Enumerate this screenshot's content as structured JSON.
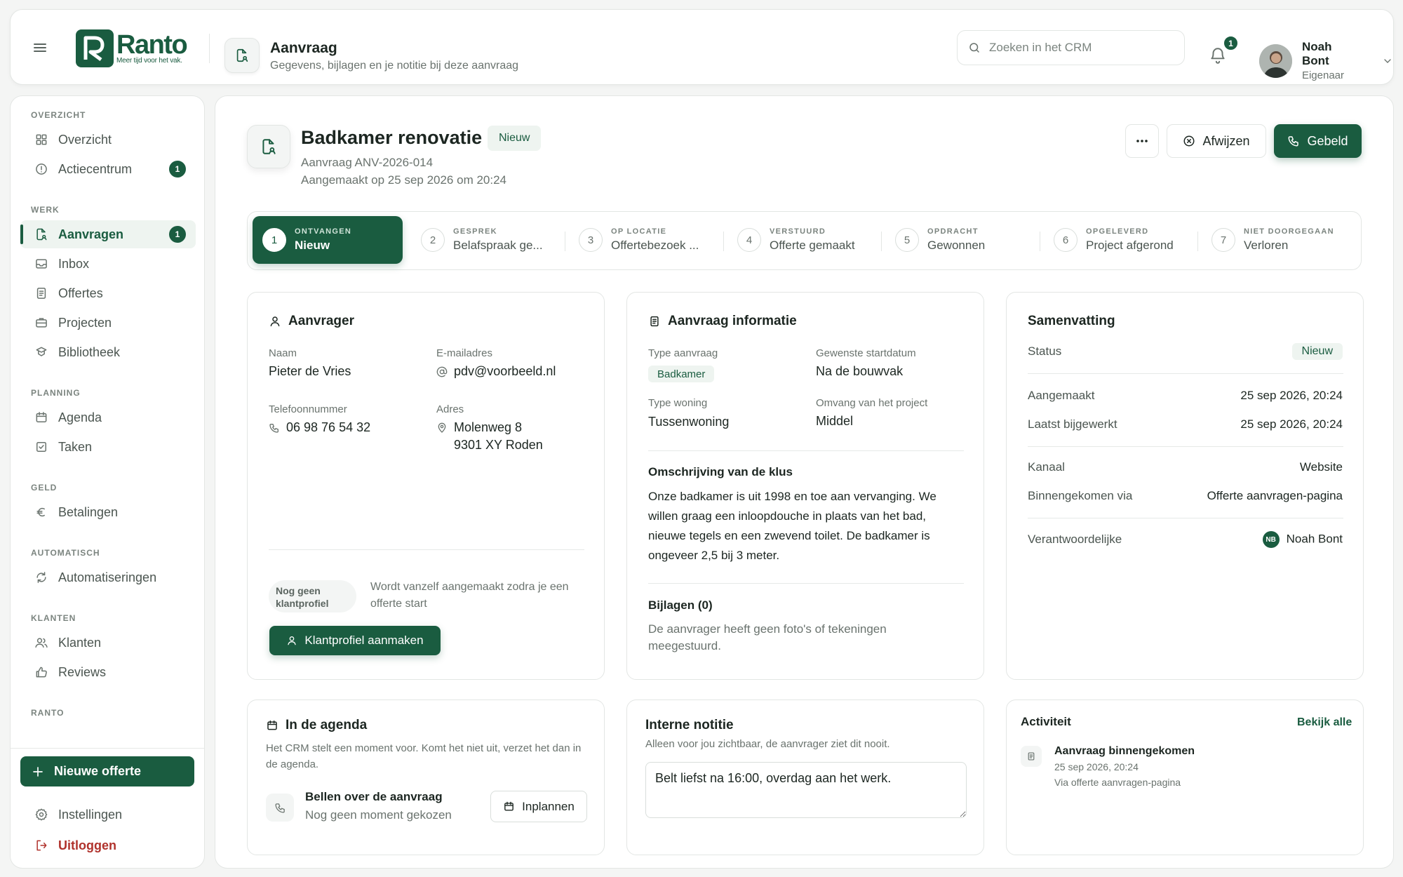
{
  "app": {
    "logo_name": "Ranto",
    "logo_tagline": "Meer tijd voor het vak.",
    "header_title": "Aanvraag",
    "header_subtitle": "Gegevens, bijlagen en je notitie bij deze aanvraag",
    "search_placeholder": "Zoeken in het CRM",
    "notification_count": "1",
    "user_name": "Noah Bont",
    "user_role": "Eigenaar"
  },
  "sidebar": {
    "sections": {
      "overzicht": "OVERZICHT",
      "werk": "WERK",
      "planning": "PLANNING",
      "geld": "GELD",
      "automatisch": "AUTOMATISCH",
      "klanten": "KLANTEN",
      "ranto": "RANTO"
    },
    "items": {
      "overzicht": "Overzicht",
      "actiecentrum": "Actiecentrum",
      "actiecentrum_badge": "1",
      "aanvragen": "Aanvragen",
      "aanvragen_badge": "1",
      "inbox": "Inbox",
      "offertes": "Offertes",
      "projecten": "Projecten",
      "bibliotheek": "Bibliotheek",
      "agenda": "Agenda",
      "taken": "Taken",
      "betalingen": "Betalingen",
      "automatiseringen": "Automatiseringen",
      "klanten": "Klanten",
      "reviews": "Reviews"
    },
    "new_offer": "Nieuwe offerte",
    "settings": "Instellingen",
    "logout": "Uitloggen"
  },
  "request": {
    "title": "Badkamer renovatie",
    "status_badge": "Nieuw",
    "id_line": "Aanvraag ANV-2026-014",
    "created_line": "Aangemaakt op 25 sep 2026 om 20:24",
    "more_label": "···",
    "reject_label": "Afwijzen",
    "called_label": "Gebeld"
  },
  "pipeline": [
    {
      "num": "1",
      "label": "ONTVANGEN",
      "value": "Nieuw"
    },
    {
      "num": "2",
      "label": "GESPREK",
      "value": "Belafspraak ge..."
    },
    {
      "num": "3",
      "label": "OP LOCATIE",
      "value": "Offertebezoek ..."
    },
    {
      "num": "4",
      "label": "VERSTUURD",
      "value": "Offerte gemaakt"
    },
    {
      "num": "5",
      "label": "OPDRACHT",
      "value": "Gewonnen"
    },
    {
      "num": "6",
      "label": "OPGELEVERD",
      "value": "Project afgerond"
    },
    {
      "num": "7",
      "label": "NIET DOORGEGAAN",
      "value": "Verloren"
    }
  ],
  "requester": {
    "title": "Aanvrager",
    "name_label": "Naam",
    "name": "Pieter de Vries",
    "email_label": "E-mailadres",
    "email": "pdv@voorbeeld.nl",
    "phone_label": "Telefoonnummer",
    "phone": "06 98 76 54 32",
    "address_label": "Adres",
    "address_line1": "Molenweg 8",
    "address_line2": "9301 XY Roden",
    "no_profile": "Nog geen klantprofiel",
    "no_profile_hint": "Wordt vanzelf aangemaakt zodra je een offerte start",
    "create_profile": "Klantprofiel aanmaken"
  },
  "info": {
    "title": "Aanvraag informatie",
    "type_label": "Type aanvraag",
    "type_value": "Badkamer",
    "start_label": "Gewenste startdatum",
    "start_value": "Na de bouwvak",
    "housing_label": "Type woning",
    "housing_value": "Tussenwoning",
    "scope_label": "Omvang van het project",
    "scope_value": "Middel",
    "description_title": "Omschrijving van de klus",
    "description": "Onze badkamer is uit 1998 en toe aan vervanging. We willen graag een inloopdouche in plaats van het bad, nieuwe tegels en een zwevend toilet. De badkamer is ongeveer 2,5 bij 3 meter.",
    "attachments_title": "Bijlagen (0)",
    "attachments_empty": "De aanvrager heeft geen foto's of tekeningen meegestuurd."
  },
  "summary": {
    "title": "Samenvatting",
    "status_label": "Status",
    "status_value": "Nieuw",
    "created_label": "Aangemaakt",
    "created_value": "25 sep 2026, 20:24",
    "updated_label": "Laatst bijgewerkt",
    "updated_value": "25 sep 2026, 20:24",
    "channel_label": "Kanaal",
    "channel_value": "Website",
    "via_label": "Binnengekomen via",
    "via_value": "Offerte aanvragen-pagina",
    "owner_label": "Verantwoordelijke",
    "owner_initials": "NB",
    "owner_value": "Noah Bont"
  },
  "agenda": {
    "title": "In de agenda",
    "hint": "Het CRM stelt een moment voor. Komt het niet uit, verzet het dan in de agenda.",
    "item_title": "Bellen over de aanvraag",
    "item_sub": "Nog geen moment gekozen",
    "plan_button": "Inplannen"
  },
  "note": {
    "title": "Interne notitie",
    "hint": "Alleen voor jou zichtbaar, de aanvrager ziet dit nooit.",
    "value": "Belt liefst na 16:00, overdag aan het werk."
  },
  "activity": {
    "title": "Activiteit",
    "see_all": "Bekijk alle",
    "item_title": "Aanvraag binnengekomen",
    "item_time": "25 sep 2026, 20:24",
    "item_via": "Via offerte aanvragen-pagina"
  },
  "colors": {
    "brand": "#1a5c40",
    "danger": "#b0322c"
  }
}
